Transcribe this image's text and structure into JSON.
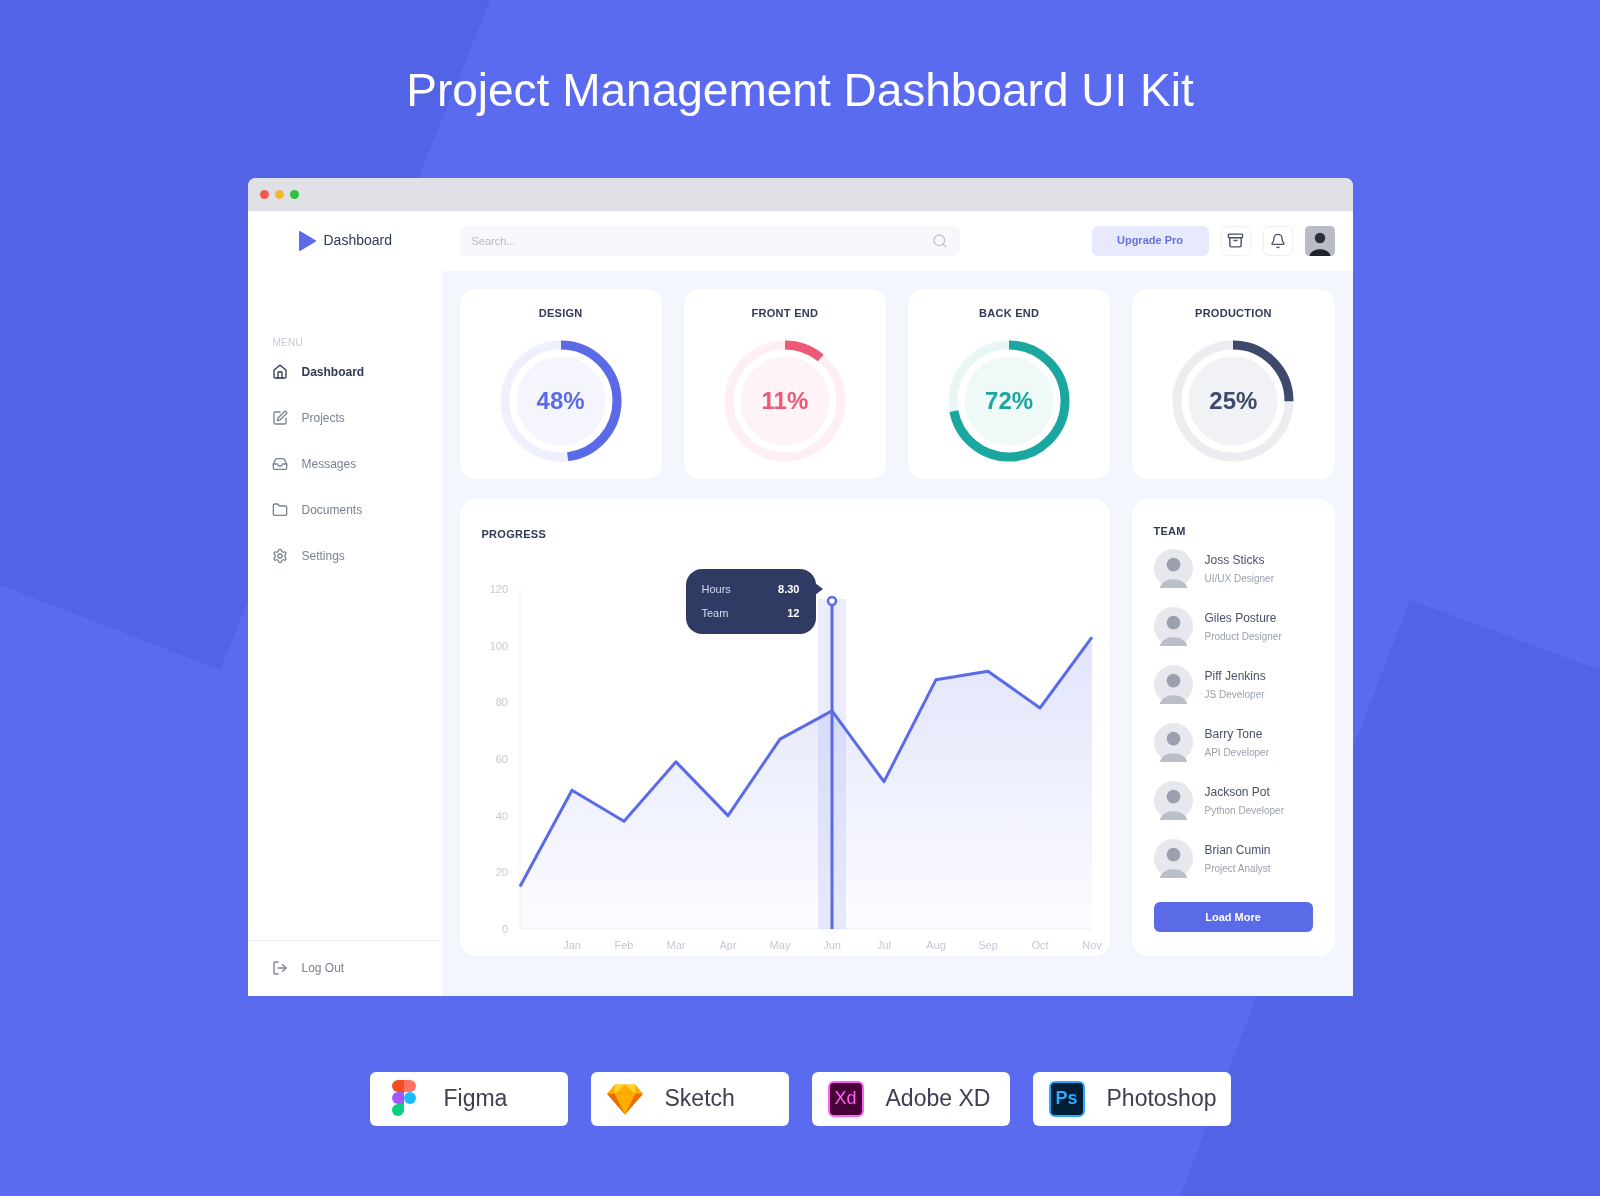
{
  "page_title": "Project Management Dashboard UI Kit",
  "header": {
    "logo_text": "Dashboard",
    "search": {
      "placeholder": "Search..."
    },
    "upgrade_button": "Upgrade Pro"
  },
  "sidebar": {
    "section_label": "MENU",
    "items": [
      {
        "label": "Dashboard",
        "selected": true
      },
      {
        "label": "Projects",
        "selected": false
      },
      {
        "label": "Messages",
        "selected": false
      },
      {
        "label": "Documents",
        "selected": false
      },
      {
        "label": "Settings",
        "selected": false
      }
    ],
    "logout": "Log Out"
  },
  "stat_cards": [
    {
      "title": "DESIGN",
      "value": "48%",
      "level": 0.48,
      "color": "#5b6be8"
    },
    {
      "title": "FRONT END",
      "value": "11%",
      "level": 0.11,
      "color": "#ec5a78"
    },
    {
      "title": "BACK END",
      "value": "72%",
      "level": 0.72,
      "color": "#1aa7a0"
    },
    {
      "title": "PRODUCTION",
      "value": "25%",
      "level": 0.25,
      "color": "#3d4a6b"
    }
  ],
  "progress": {
    "title": "PROGRESS",
    "tooltip": [
      {
        "label": "Hours",
        "value": "8.30"
      },
      {
        "label": "Team",
        "value": "12"
      }
    ],
    "chart_data": {
      "type": "area",
      "categories": [
        null,
        "Jan",
        "Feb",
        "Mar",
        "Apr",
        "May",
        "Jun",
        "Jul",
        "Aug",
        "Sep",
        "Oct",
        "Nov"
      ],
      "series": [
        {
          "color": "#5b6be8",
          "values": [
            15,
            49,
            38,
            59,
            40,
            67,
            77,
            52,
            88,
            91,
            78,
            103
          ]
        }
      ],
      "ylim": [
        0,
        120
      ],
      "yticks": [
        0,
        20,
        40,
        60,
        80,
        100,
        120
      ],
      "annotations": [
        {
          "x": "Jun"
        }
      ]
    }
  },
  "team": {
    "title": "TEAM",
    "members": [
      {
        "name": "Joss Sticks",
        "role": "UI/UX Designer"
      },
      {
        "name": "Giles Posture",
        "role": "Product Designer"
      },
      {
        "name": "Piff Jenkins",
        "role": "JS Developer"
      },
      {
        "name": "Barry Tone",
        "role": "API Developer"
      },
      {
        "name": "Jackson Pot",
        "role": "Python Developer"
      },
      {
        "name": "Brian Cumin",
        "role": "Project Analyst"
      }
    ],
    "button": "Load More"
  },
  "tools": [
    {
      "name": "Figma",
      "kind": "figma"
    },
    {
      "name": "Sketch",
      "kind": "sketch"
    },
    {
      "name": "Adobe XD",
      "kind": "xd",
      "icon_text": "Xd"
    },
    {
      "name": "Photoshop",
      "kind": "ps",
      "icon_text": "Ps"
    }
  ]
}
